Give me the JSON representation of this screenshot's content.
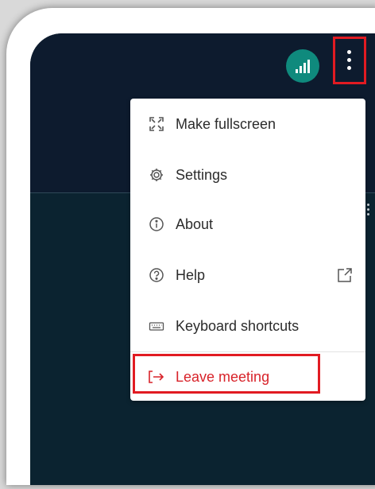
{
  "menu": {
    "items": [
      {
        "label": "Make fullscreen",
        "icon": "fullscreen-icon"
      },
      {
        "label": "Settings",
        "icon": "gear-icon"
      },
      {
        "label": "About",
        "icon": "info-icon"
      },
      {
        "label": "Help",
        "icon": "help-icon",
        "trailing_icon": "external-link-icon"
      },
      {
        "label": "Keyboard shortcuts",
        "icon": "keyboard-icon"
      },
      {
        "label": "Leave meeting",
        "icon": "leave-icon"
      }
    ]
  },
  "colors": {
    "highlight": "#e11b22",
    "leave_text": "#d8232a",
    "screen_bg": "#0d1b2e",
    "signal_bg": "#0f8a7d"
  },
  "icons": {
    "signal": "signal-strength-icon",
    "more": "more-vertical-icon"
  }
}
